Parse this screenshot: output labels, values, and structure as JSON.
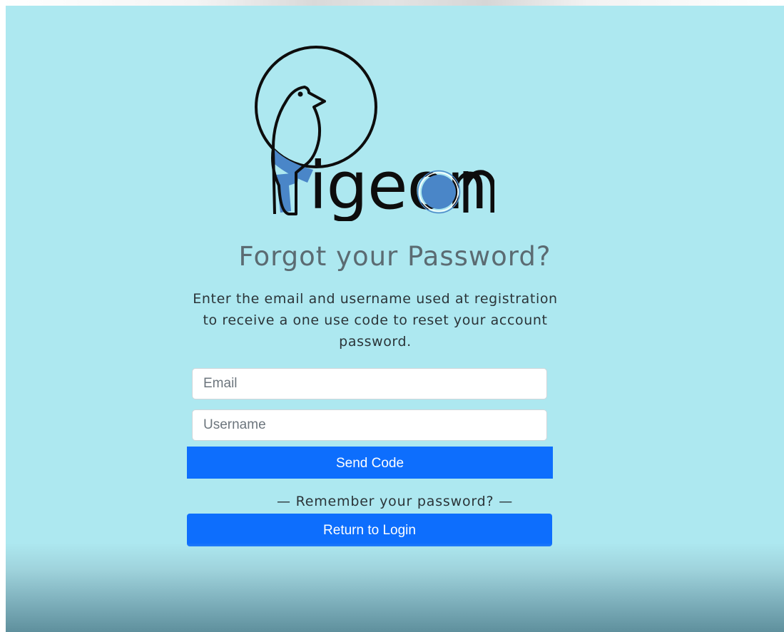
{
  "logo": {
    "wordmark": "igeon",
    "icon": "pigeon-logo-icon"
  },
  "form": {
    "title": "Forgot your Password?",
    "description": "Enter the email and username used at registration to receive a one use code to reset your account password.",
    "email_placeholder": "Email",
    "username_placeholder": "Username",
    "send_label": "Send Code",
    "remember_text": "— Remember your password? —",
    "return_label": "Return to Login"
  },
  "colors": {
    "background": "#ade8f0",
    "primary_button": "#0d6efd",
    "logo_accent": "#4a86c8"
  }
}
